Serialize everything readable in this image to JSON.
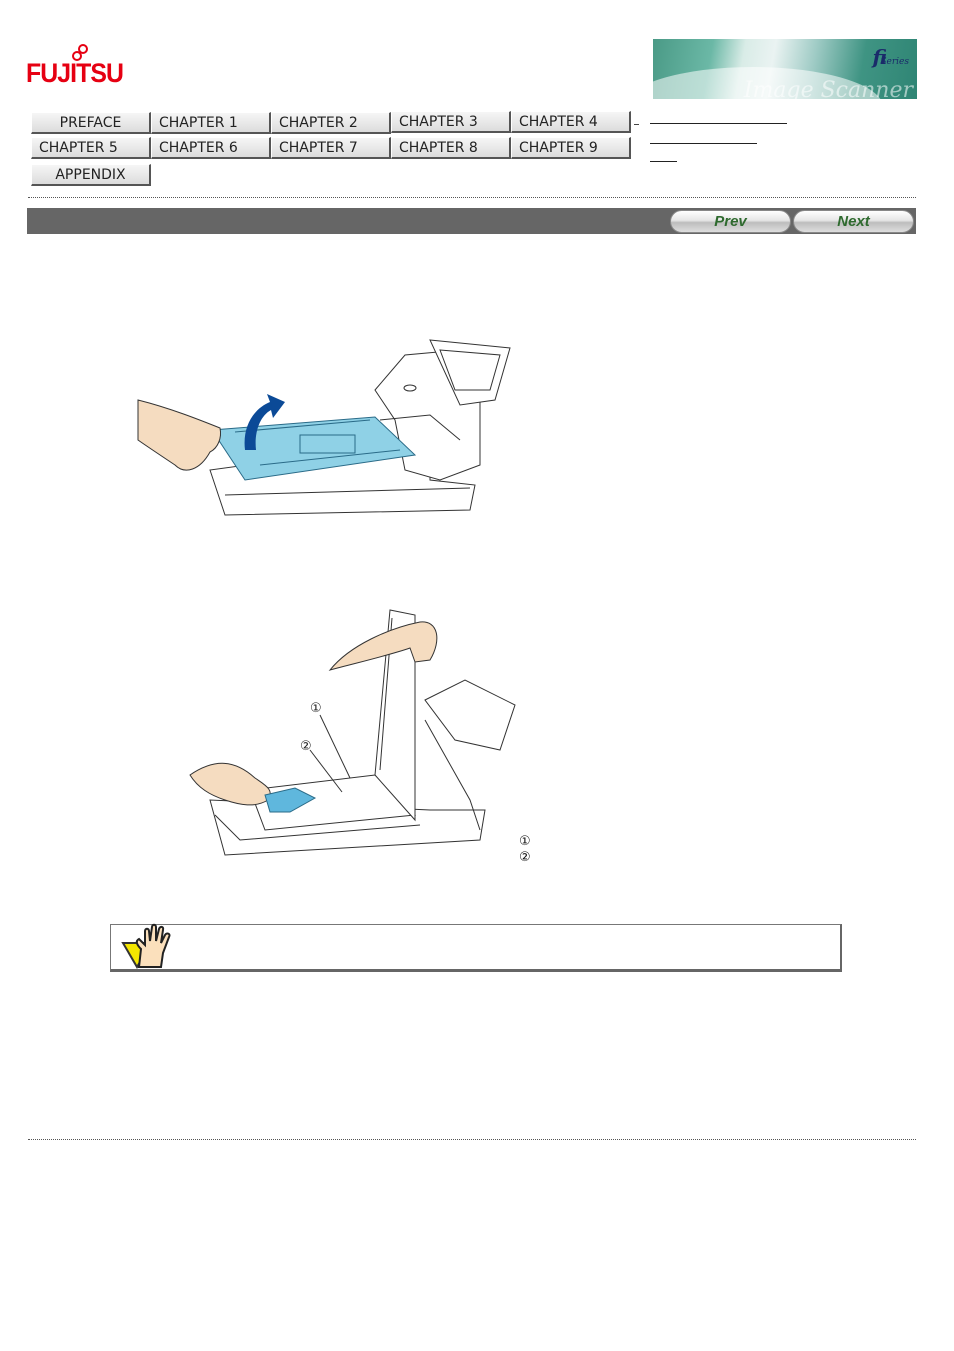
{
  "header": {
    "logo_text": "FUJITSU",
    "logo_color": "#e60012",
    "banner": {
      "brand": "fi",
      "brand_sub": "Series",
      "tagline": "Image Scanner"
    }
  },
  "nav": {
    "rows": [
      [
        {
          "label": "PREFACE",
          "name": "nav-preface"
        },
        {
          "label": "CHAPTER 1",
          "name": "nav-chapter-1"
        },
        {
          "label": "CHAPTER 2",
          "name": "nav-chapter-2"
        },
        {
          "label": "CHAPTER 3",
          "name": "nav-chapter-3"
        },
        {
          "label": "CHAPTER 4",
          "name": "nav-chapter-4"
        }
      ],
      [
        {
          "label": "CHAPTER 5",
          "name": "nav-chapter-5"
        },
        {
          "label": "CHAPTER 6",
          "name": "nav-chapter-6"
        },
        {
          "label": "CHAPTER 7",
          "name": "nav-chapter-7"
        },
        {
          "label": "CHAPTER 8",
          "name": "nav-chapter-8"
        },
        {
          "label": "CHAPTER 9",
          "name": "nav-chapter-9"
        }
      ],
      [
        {
          "label": "APPENDIX",
          "name": "nav-appendix"
        }
      ]
    ],
    "side_links_count": 3
  },
  "pager": {
    "prev_label": "Prev",
    "next_label": "Next",
    "text_color": "#2e6a2e",
    "bar_color": "#666666"
  },
  "figures": {
    "fig1": {
      "description": "hand lifting blue document cover of flatbed scanner",
      "arrow_color": "#0b4a97",
      "cover_color": "#8fd1e6"
    },
    "fig2": {
      "description": "hand wiping flatbed glass with cloth while cover held open",
      "callouts": [
        "①",
        "②"
      ]
    }
  },
  "legend": {
    "items": [
      "①",
      "②"
    ]
  },
  "caution": {
    "icon": "caution-hand-icon"
  }
}
